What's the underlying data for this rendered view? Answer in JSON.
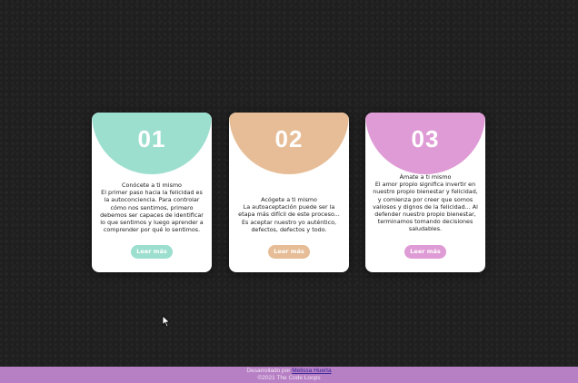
{
  "colors": {
    "card1": "#9ddfcf",
    "card2": "#e6bd96",
    "card3": "#df9bd5",
    "footer": "#b77fc4"
  },
  "cards": [
    {
      "number": "01",
      "title": "Conócete a ti mismo",
      "body": "El primer paso hacia la felicidad es la autoconciencia. Para controlar cómo nos sentimos, primero debemos ser capaces de identificar lo que sentimos y luego aprender a comprender por qué lo sentimos.",
      "button": "Leer más"
    },
    {
      "number": "02",
      "title": "Acógete a ti mismo",
      "body": "La autoaceptación puede ser la etapa más difícil de este proceso... Es aceptar nuestro yo auténtico, defectos, defectos y todo.",
      "button": "Leer más"
    },
    {
      "number": "03",
      "title": "Ámate a ti mismo",
      "body": "El amor propio significa invertir en nuestro propio bienestar y felicidad, y comienza por creer que somos valiosos y dignos de la felicidad... Al defender nuestro propio bienestar, terminamos tomando decisiones saludables.",
      "button": "Leer más"
    }
  ],
  "footer": {
    "prefix": "Desarrollado por ",
    "author": "Melissa Huerta",
    "copyright": "©2021 The Code Loops"
  },
  "cursor": {
    "icon": "mouse-pointer-icon"
  }
}
